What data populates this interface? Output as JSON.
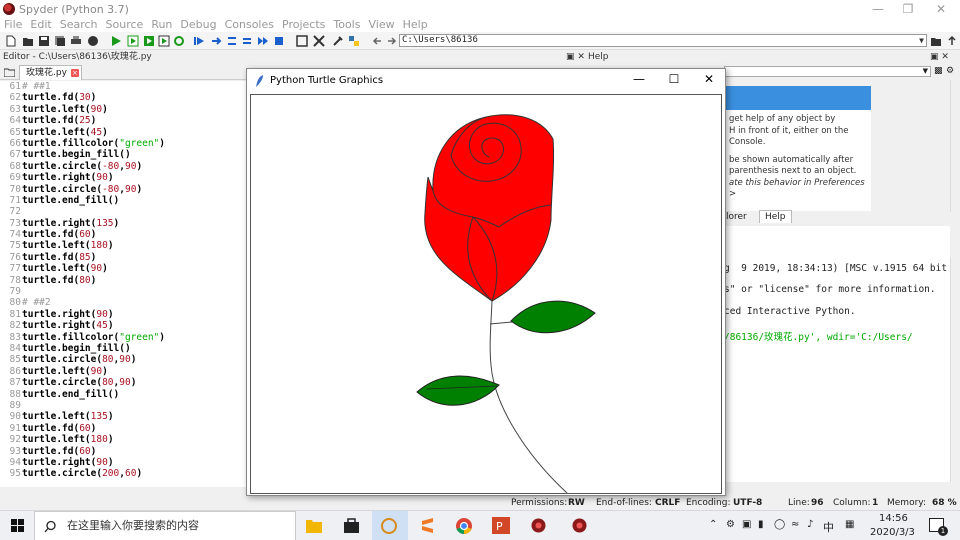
{
  "window": {
    "title": "Spyder (Python 3.7)"
  },
  "menu": [
    "File",
    "Edit",
    "Search",
    "Source",
    "Run",
    "Debug",
    "Consoles",
    "Projects",
    "Tools",
    "View",
    "Help"
  ],
  "toolbar": {
    "path": "C:\\Users\\86136"
  },
  "editor": {
    "header": "Editor - C:\\Users\\86136\\玫瑰花.py",
    "tab": "玫瑰花.py",
    "lines": [
      {
        "n": "61",
        "t": "# ##1",
        "k": "c"
      },
      {
        "n": "62",
        "t": "turtle.fd(30)"
      },
      {
        "n": "63",
        "t": "turtle.left(90)"
      },
      {
        "n": "64",
        "t": "turtle.fd(25)"
      },
      {
        "n": "65",
        "t": "turtle.left(45)"
      },
      {
        "n": "66",
        "t": "turtle.fillcolor(\"green\")"
      },
      {
        "n": "67",
        "t": "turtle.begin_fill()"
      },
      {
        "n": "68",
        "t": "turtle.circle(-80,90)"
      },
      {
        "n": "69",
        "t": "turtle.right(90)"
      },
      {
        "n": "70",
        "t": "turtle.circle(-80,90)"
      },
      {
        "n": "71",
        "t": "turtle.end_fill()"
      },
      {
        "n": "72",
        "t": ""
      },
      {
        "n": "73",
        "t": "turtle.right(135)"
      },
      {
        "n": "74",
        "t": "turtle.fd(60)"
      },
      {
        "n": "75",
        "t": "turtle.left(180)"
      },
      {
        "n": "76",
        "t": "turtle.fd(85)"
      },
      {
        "n": "77",
        "t": "turtle.left(90)"
      },
      {
        "n": "78",
        "t": "turtle.fd(80)"
      },
      {
        "n": "79",
        "t": ""
      },
      {
        "n": "80",
        "t": "# ##2",
        "k": "c"
      },
      {
        "n": "81",
        "t": "turtle.right(90)"
      },
      {
        "n": "82",
        "t": "turtle.right(45)"
      },
      {
        "n": "83",
        "t": "turtle.fillcolor(\"green\")"
      },
      {
        "n": "84",
        "t": "turtle.begin_fill()"
      },
      {
        "n": "85",
        "t": "turtle.circle(80,90)"
      },
      {
        "n": "86",
        "t": "turtle.left(90)"
      },
      {
        "n": "87",
        "t": "turtle.circle(80,90)"
      },
      {
        "n": "88",
        "t": "turtle.end_fill()"
      },
      {
        "n": "89",
        "t": ""
      },
      {
        "n": "90",
        "t": "turtle.left(135)"
      },
      {
        "n": "91",
        "t": "turtle.fd(60)"
      },
      {
        "n": "92",
        "t": "turtle.left(180)"
      },
      {
        "n": "93",
        "t": "turtle.fd(60)"
      },
      {
        "n": "94",
        "t": "turtle.right(90)"
      },
      {
        "n": "95",
        "t": "turtle.circle(200,60)"
      }
    ]
  },
  "help": {
    "header": "Help",
    "card_lines": [
      "get help of any object by",
      "H in front of it, either on the",
      "Console.",
      "be shown automatically after",
      "parenthesis next to an object.",
      "ate this behavior in Preferences >"
    ],
    "tabs": [
      "lorer",
      "Help"
    ]
  },
  "console": {
    "lines": [
      "g  9 2019, 18:34:13) [MSC v.1915 64 bit",
      "s\" or \"license\" for more information.",
      "ced Interactive Python.",
      "/86136/玫瑰花.py', wdir='C:/Users/"
    ]
  },
  "turtle_window": {
    "title": "Python Turtle Graphics"
  },
  "statusbar": {
    "permissions_label": "Permissions:",
    "permissions": "RW",
    "eol_label": "End-of-lines:",
    "eol": "CRLF",
    "encoding_label": "Encoding:",
    "encoding": "UTF-8",
    "line_label": "Line:",
    "line": "96",
    "column_label": "Column:",
    "column": "1",
    "memory_label": "Memory:",
    "memory": "68 %"
  },
  "taskbar": {
    "search_placeholder": "在这里输入你要搜索的内容",
    "ime": "中",
    "time": "14:56",
    "date": "2020/3/3",
    "notif_count": "1"
  },
  "colors": {
    "petal": "#ff0000",
    "leaf": "#008000",
    "accent": "#3a8fde"
  }
}
